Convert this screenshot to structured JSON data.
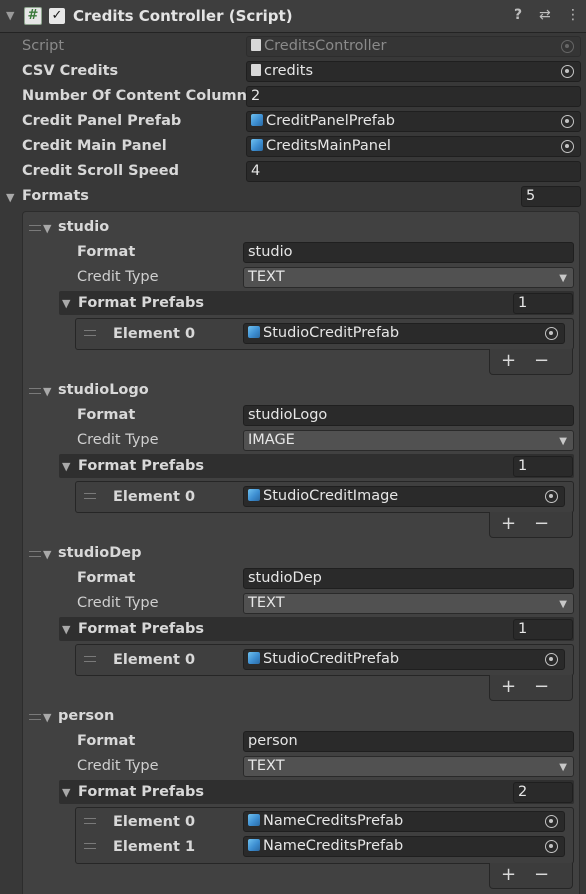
{
  "component": {
    "title": "Credits Controller (Script)",
    "enabled": true
  },
  "fields": {
    "script_label": "Script",
    "script_value": "CreditsController",
    "csv_label": "CSV Credits",
    "csv_value": "credits",
    "columns_label": "Number Of Content Columns",
    "columns_value": "2",
    "panel_prefab_label": "Credit Panel Prefab",
    "panel_prefab_value": "CreditPanelPrefab",
    "main_panel_label": "Credit Main Panel",
    "main_panel_value": "CreditsMainPanel",
    "scroll_speed_label": "Credit Scroll Speed",
    "scroll_speed_value": "4"
  },
  "formats": {
    "label": "Formats",
    "count": "5",
    "items": [
      {
        "name": "studio",
        "format_label": "Format",
        "format_value": "studio",
        "type_label": "Credit Type",
        "type_value": "TEXT",
        "prefabs_label": "Format Prefabs",
        "prefabs_count": "1",
        "elements": [
          {
            "label": "Element 0",
            "value": "StudioCreditPrefab"
          }
        ]
      },
      {
        "name": "studioLogo",
        "format_label": "Format",
        "format_value": "studioLogo",
        "type_label": "Credit Type",
        "type_value": "IMAGE",
        "prefabs_label": "Format Prefabs",
        "prefabs_count": "1",
        "elements": [
          {
            "label": "Element 0",
            "value": "StudioCreditImage"
          }
        ]
      },
      {
        "name": "studioDep",
        "format_label": "Format",
        "format_value": "studioDep",
        "type_label": "Credit Type",
        "type_value": "TEXT",
        "prefabs_label": "Format Prefabs",
        "prefabs_count": "1",
        "elements": [
          {
            "label": "Element 0",
            "value": "StudioCreditPrefab"
          }
        ]
      },
      {
        "name": "person",
        "format_label": "Format",
        "format_value": "person",
        "type_label": "Credit Type",
        "type_value": "TEXT",
        "prefabs_label": "Format Prefabs",
        "prefabs_count": "2",
        "elements": [
          {
            "label": "Element 0",
            "value": "NameCreditsPrefab"
          },
          {
            "label": "Element 1",
            "value": "NameCreditsPrefab"
          }
        ]
      }
    ]
  },
  "list_controls": {
    "add": "+",
    "remove": "−"
  },
  "icons": {
    "script": "hash-icon",
    "help": "help-icon",
    "presets": "presets-icon",
    "menu": "kebab-menu-icon",
    "prefab": "prefab-cube-icon",
    "text_asset": "text-asset-icon",
    "object_picker": "object-picker-icon"
  },
  "colors": {
    "background": "#383838",
    "field": "#2a2a2a",
    "prefab_icon": "#4aa3df",
    "check_bg": "#e8e8e8"
  }
}
